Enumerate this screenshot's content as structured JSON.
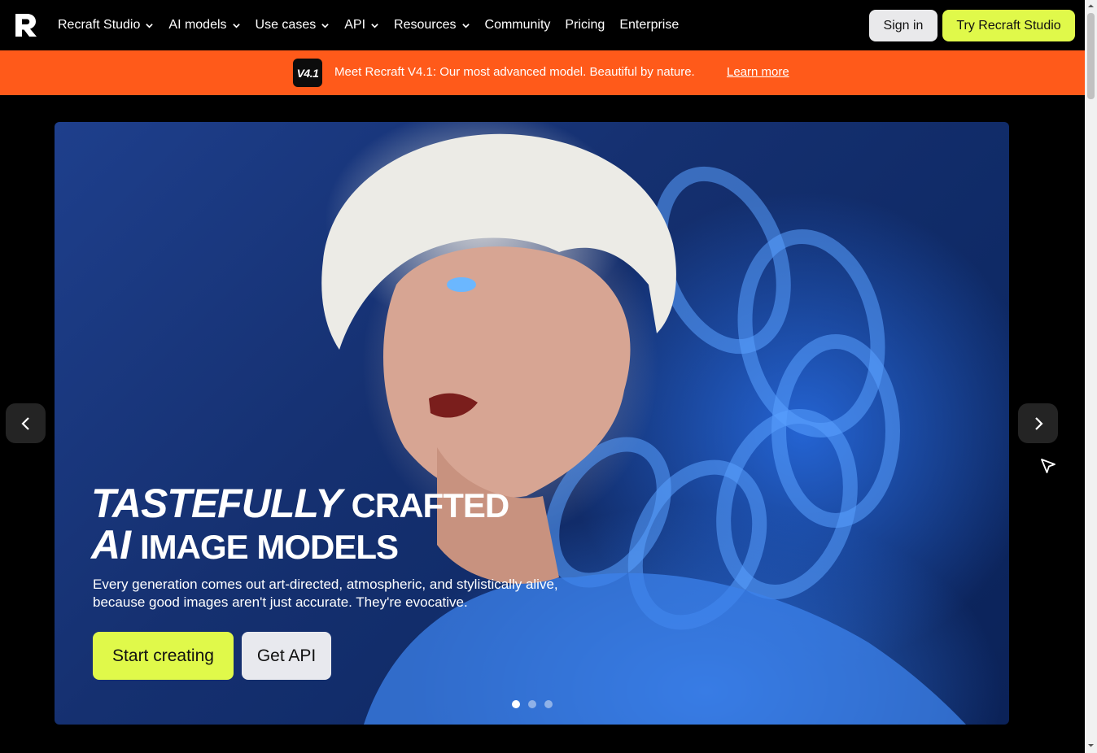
{
  "nav": {
    "logo": "R",
    "items": [
      {
        "label": "Recraft Studio",
        "has_chevron": true
      },
      {
        "label": "AI models",
        "has_chevron": true
      },
      {
        "label": "Use cases",
        "has_chevron": true
      },
      {
        "label": "API",
        "has_chevron": true
      },
      {
        "label": "Resources",
        "has_chevron": true
      },
      {
        "label": "Community",
        "has_chevron": false
      },
      {
        "label": "Pricing",
        "has_chevron": false
      },
      {
        "label": "Enterprise",
        "has_chevron": false
      }
    ],
    "sign_in": "Sign in",
    "try_cta": "Try Recraft Studio"
  },
  "announcement": {
    "badge": "V4.1",
    "text": "Meet Recraft V4.1: Our most advanced model. Beautiful by nature.",
    "link": "Learn more"
  },
  "hero": {
    "headline_line1_italic": "TASTEFULLY",
    "headline_line1": "CRAFTED",
    "headline_line2_italic": "AI",
    "headline_line2": "IMAGE MODELS",
    "subtext": "Every generation comes out art-directed, atmospheric, and stylistically alive, because good images aren't just accurate. They're evocative.",
    "primary_cta": "Start creating",
    "secondary_cta": "Get API",
    "slides": 3,
    "active_slide": 1
  },
  "colors": {
    "accent_lime": "#e0f94a",
    "announce_orange": "#ff5a1a",
    "background": "#000000"
  },
  "icons": [
    "recraft-logo-icon",
    "chevron-down-icon",
    "chevron-left-icon",
    "chevron-right-icon",
    "cursor-icon"
  ]
}
